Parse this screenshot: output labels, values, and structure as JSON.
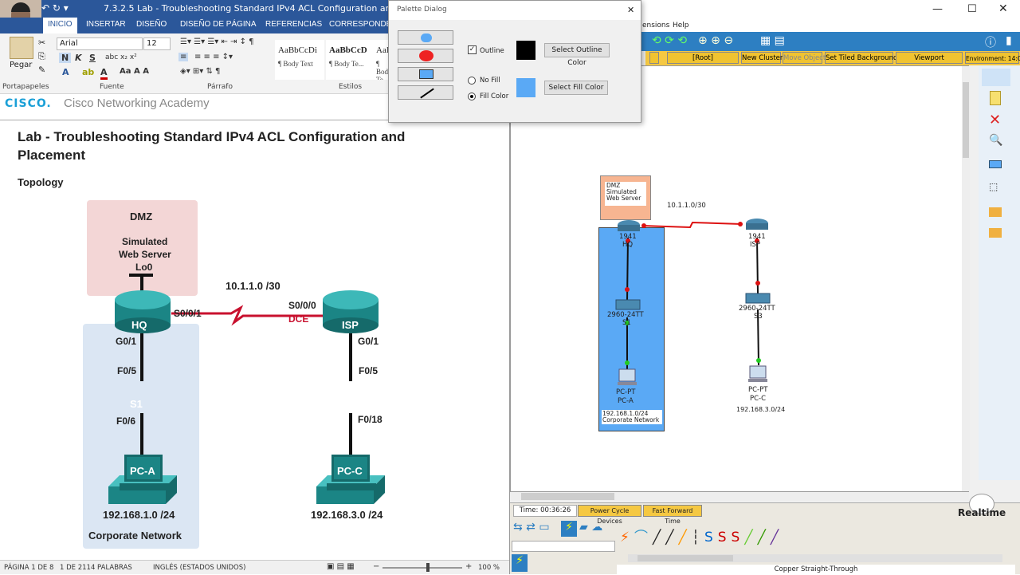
{
  "word": {
    "title": "7.3.2.5 Lab - Troubleshooting Standard IPv4 ACL Configuration and Placement - W",
    "tabs": [
      "INICIO",
      "INSERTAR",
      "DISEÑO",
      "DISEÑO DE PÁGINA",
      "REFERENCIAS",
      "CORRESPONDEN"
    ],
    "ribbon": {
      "paste_label": "Pegar",
      "font_name": "Arial",
      "font_size": "12",
      "groups": [
        "Portapapeles",
        "Fuente",
        "Párrafo",
        "Estilos"
      ],
      "styles": [
        {
          "sample": "AaBbCcDi",
          "label": "¶ Body Text"
        },
        {
          "sample": "AaBbCcD",
          "label": "¶ Body Te..."
        },
        {
          "sample": "AaI",
          "label": "¶ Body Te..."
        }
      ]
    },
    "doc": {
      "cisco": "CISCO.",
      "academy": "Cisco Networking Academy",
      "title": "Lab - Troubleshooting Standard IPv4 ACL Configuration and Placement",
      "topology_heading": "Topology",
      "diagram": {
        "dmz": "DMZ",
        "sim1": "Simulated",
        "sim2": "Web Server",
        "lo0": "Lo0",
        "hq": "HQ",
        "isp": "ISP",
        "s1": "S1",
        "s3": "S3",
        "pca": "PC-A",
        "pcc": "PC-C",
        "link": "10.1.1.0 /30",
        "hq_s": "S0/0/1",
        "isp_s": "S0/0/0",
        "dce": "DCE",
        "hq_g": "G0/1",
        "isp_g": "G0/1",
        "s1_f5": "F0/5",
        "s1_f6": "F0/6",
        "s3_f5": "F0/5",
        "s3_f18": "F0/18",
        "net_a": "192.168.1.0 /24",
        "net_c": "192.168.3.0 /24",
        "corp": "Corporate Network"
      }
    },
    "status": {
      "page": "PÁGINA 1 DE 8",
      "words": "1 DE 2114 PALABRAS",
      "lang": "INGLÉS (ESTADOS UNIDOS)",
      "zoom": "100 %"
    }
  },
  "palette": {
    "title": "Palette Dialog",
    "outline_label": "Outline",
    "outline_btn": "Select Outline Color",
    "no_fill": "No Fill",
    "fill_color": "Fill Color",
    "fill_btn": "Select Fill Color",
    "outline_color": "#000000",
    "fill_color_hex": "#5aa9f5"
  },
  "pt": {
    "menu_items": [
      "ensions",
      "Help"
    ],
    "bar": [
      "[Root]",
      "New Cluster",
      "Move Object",
      "Set Tiled Background",
      "Viewport",
      "Environment: 14:00:00"
    ],
    "canvas": {
      "dmz_label": "DMZ\nSimulated\nWeb Server",
      "link": "10.1.1.0/30",
      "hq_model": "1941",
      "hq": "HQ",
      "isp_model": "1941",
      "isp": "ISP",
      "s1_model": "2960-24TT",
      "s1": "S1",
      "s3_model": "2960-24TT",
      "s3": "S3",
      "pca_model": "PC-PT",
      "pca": "PC-A",
      "pcc_model": "PC-PT",
      "pcc": "PC-C",
      "net_a": "192.168.1.0/24",
      "corp": "Corporate Network",
      "net_c": "192.168.3.0/24"
    },
    "time": "Time: 00:36:26",
    "power_cycle": "Power Cycle Devices",
    "fast_forward": "Fast Forward Time",
    "realtime": "Realtime",
    "cable_name": "Copper Straight-Through"
  }
}
